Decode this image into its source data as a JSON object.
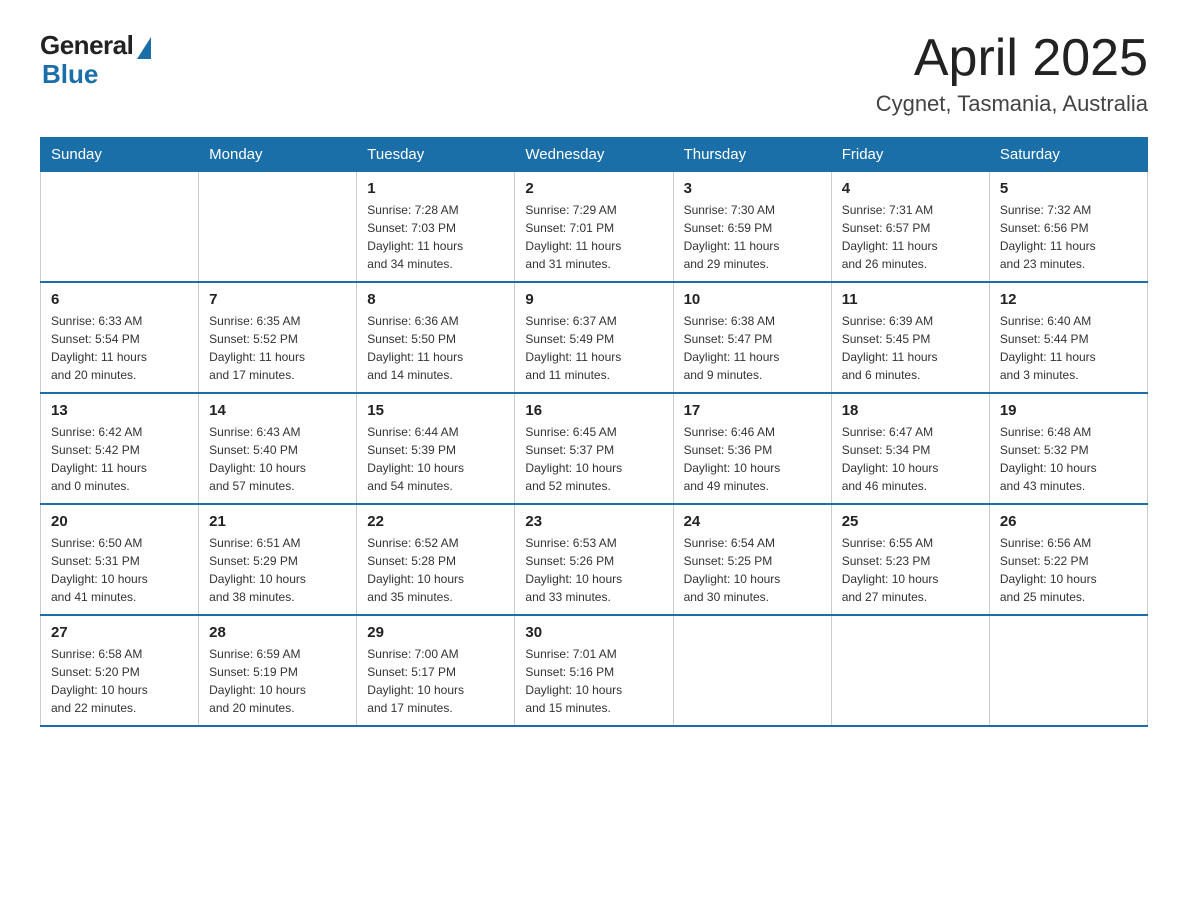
{
  "logo": {
    "general": "General",
    "blue": "Blue"
  },
  "title": "April 2025",
  "subtitle": "Cygnet, Tasmania, Australia",
  "days_of_week": [
    "Sunday",
    "Monday",
    "Tuesday",
    "Wednesday",
    "Thursday",
    "Friday",
    "Saturday"
  ],
  "weeks": [
    [
      {
        "day": "",
        "info": ""
      },
      {
        "day": "",
        "info": ""
      },
      {
        "day": "1",
        "info": "Sunrise: 7:28 AM\nSunset: 7:03 PM\nDaylight: 11 hours\nand 34 minutes."
      },
      {
        "day": "2",
        "info": "Sunrise: 7:29 AM\nSunset: 7:01 PM\nDaylight: 11 hours\nand 31 minutes."
      },
      {
        "day": "3",
        "info": "Sunrise: 7:30 AM\nSunset: 6:59 PM\nDaylight: 11 hours\nand 29 minutes."
      },
      {
        "day": "4",
        "info": "Sunrise: 7:31 AM\nSunset: 6:57 PM\nDaylight: 11 hours\nand 26 minutes."
      },
      {
        "day": "5",
        "info": "Sunrise: 7:32 AM\nSunset: 6:56 PM\nDaylight: 11 hours\nand 23 minutes."
      }
    ],
    [
      {
        "day": "6",
        "info": "Sunrise: 6:33 AM\nSunset: 5:54 PM\nDaylight: 11 hours\nand 20 minutes."
      },
      {
        "day": "7",
        "info": "Sunrise: 6:35 AM\nSunset: 5:52 PM\nDaylight: 11 hours\nand 17 minutes."
      },
      {
        "day": "8",
        "info": "Sunrise: 6:36 AM\nSunset: 5:50 PM\nDaylight: 11 hours\nand 14 minutes."
      },
      {
        "day": "9",
        "info": "Sunrise: 6:37 AM\nSunset: 5:49 PM\nDaylight: 11 hours\nand 11 minutes."
      },
      {
        "day": "10",
        "info": "Sunrise: 6:38 AM\nSunset: 5:47 PM\nDaylight: 11 hours\nand 9 minutes."
      },
      {
        "day": "11",
        "info": "Sunrise: 6:39 AM\nSunset: 5:45 PM\nDaylight: 11 hours\nand 6 minutes."
      },
      {
        "day": "12",
        "info": "Sunrise: 6:40 AM\nSunset: 5:44 PM\nDaylight: 11 hours\nand 3 minutes."
      }
    ],
    [
      {
        "day": "13",
        "info": "Sunrise: 6:42 AM\nSunset: 5:42 PM\nDaylight: 11 hours\nand 0 minutes."
      },
      {
        "day": "14",
        "info": "Sunrise: 6:43 AM\nSunset: 5:40 PM\nDaylight: 10 hours\nand 57 minutes."
      },
      {
        "day": "15",
        "info": "Sunrise: 6:44 AM\nSunset: 5:39 PM\nDaylight: 10 hours\nand 54 minutes."
      },
      {
        "day": "16",
        "info": "Sunrise: 6:45 AM\nSunset: 5:37 PM\nDaylight: 10 hours\nand 52 minutes."
      },
      {
        "day": "17",
        "info": "Sunrise: 6:46 AM\nSunset: 5:36 PM\nDaylight: 10 hours\nand 49 minutes."
      },
      {
        "day": "18",
        "info": "Sunrise: 6:47 AM\nSunset: 5:34 PM\nDaylight: 10 hours\nand 46 minutes."
      },
      {
        "day": "19",
        "info": "Sunrise: 6:48 AM\nSunset: 5:32 PM\nDaylight: 10 hours\nand 43 minutes."
      }
    ],
    [
      {
        "day": "20",
        "info": "Sunrise: 6:50 AM\nSunset: 5:31 PM\nDaylight: 10 hours\nand 41 minutes."
      },
      {
        "day": "21",
        "info": "Sunrise: 6:51 AM\nSunset: 5:29 PM\nDaylight: 10 hours\nand 38 minutes."
      },
      {
        "day": "22",
        "info": "Sunrise: 6:52 AM\nSunset: 5:28 PM\nDaylight: 10 hours\nand 35 minutes."
      },
      {
        "day": "23",
        "info": "Sunrise: 6:53 AM\nSunset: 5:26 PM\nDaylight: 10 hours\nand 33 minutes."
      },
      {
        "day": "24",
        "info": "Sunrise: 6:54 AM\nSunset: 5:25 PM\nDaylight: 10 hours\nand 30 minutes."
      },
      {
        "day": "25",
        "info": "Sunrise: 6:55 AM\nSunset: 5:23 PM\nDaylight: 10 hours\nand 27 minutes."
      },
      {
        "day": "26",
        "info": "Sunrise: 6:56 AM\nSunset: 5:22 PM\nDaylight: 10 hours\nand 25 minutes."
      }
    ],
    [
      {
        "day": "27",
        "info": "Sunrise: 6:58 AM\nSunset: 5:20 PM\nDaylight: 10 hours\nand 22 minutes."
      },
      {
        "day": "28",
        "info": "Sunrise: 6:59 AM\nSunset: 5:19 PM\nDaylight: 10 hours\nand 20 minutes."
      },
      {
        "day": "29",
        "info": "Sunrise: 7:00 AM\nSunset: 5:17 PM\nDaylight: 10 hours\nand 17 minutes."
      },
      {
        "day": "30",
        "info": "Sunrise: 7:01 AM\nSunset: 5:16 PM\nDaylight: 10 hours\nand 15 minutes."
      },
      {
        "day": "",
        "info": ""
      },
      {
        "day": "",
        "info": ""
      },
      {
        "day": "",
        "info": ""
      }
    ]
  ]
}
